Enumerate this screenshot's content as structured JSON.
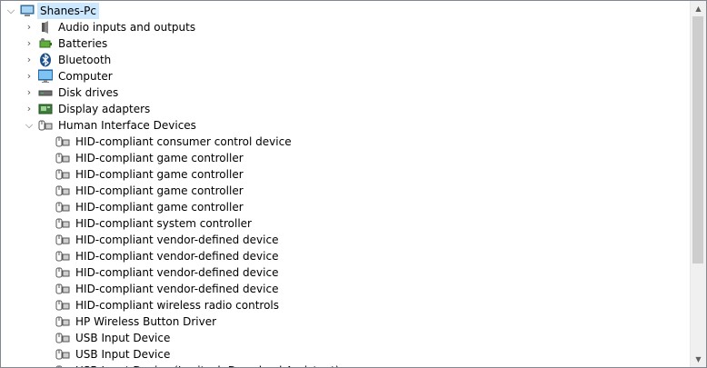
{
  "tree": {
    "root": {
      "label": "Shanes-Pc",
      "icon": "computer-icon",
      "expanded": true
    },
    "categories": [
      {
        "label": "Audio inputs and outputs",
        "icon": "speaker-icon",
        "expanded": false
      },
      {
        "label": "Batteries",
        "icon": "battery-icon",
        "expanded": false
      },
      {
        "label": "Bluetooth",
        "icon": "bluetooth-icon",
        "expanded": false
      },
      {
        "label": "Computer",
        "icon": "monitor-icon",
        "expanded": false
      },
      {
        "label": "Disk drives",
        "icon": "disk-drive-icon",
        "expanded": false
      },
      {
        "label": "Display adapters",
        "icon": "display-adapter-icon",
        "expanded": false
      },
      {
        "label": "Human Interface Devices",
        "icon": "hid-icon",
        "expanded": true
      }
    ],
    "hid_devices": [
      {
        "label": "HID-compliant consumer control device",
        "icon": "hid-icon"
      },
      {
        "label": "HID-compliant game controller",
        "icon": "hid-icon"
      },
      {
        "label": "HID-compliant game controller",
        "icon": "hid-icon"
      },
      {
        "label": "HID-compliant game controller",
        "icon": "hid-icon"
      },
      {
        "label": "HID-compliant game controller",
        "icon": "hid-icon"
      },
      {
        "label": "HID-compliant system controller",
        "icon": "hid-icon"
      },
      {
        "label": "HID-compliant vendor-defined device",
        "icon": "hid-icon"
      },
      {
        "label": "HID-compliant vendor-defined device",
        "icon": "hid-icon"
      },
      {
        "label": "HID-compliant vendor-defined device",
        "icon": "hid-icon"
      },
      {
        "label": "HID-compliant vendor-defined device",
        "icon": "hid-icon"
      },
      {
        "label": "HID-compliant wireless radio controls",
        "icon": "hid-icon"
      },
      {
        "label": "HP Wireless Button Driver",
        "icon": "hid-icon"
      },
      {
        "label": "USB Input Device",
        "icon": "hid-icon"
      },
      {
        "label": "USB Input Device",
        "icon": "hid-icon"
      },
      {
        "label": "USB Input Device (Logitech Download Assistant)",
        "icon": "hid-icon"
      }
    ]
  },
  "colors": {
    "selection": "#cce8ff",
    "border": "#828790",
    "scrollbar": "#f0f0f0",
    "thumb": "#cdcdcd"
  }
}
